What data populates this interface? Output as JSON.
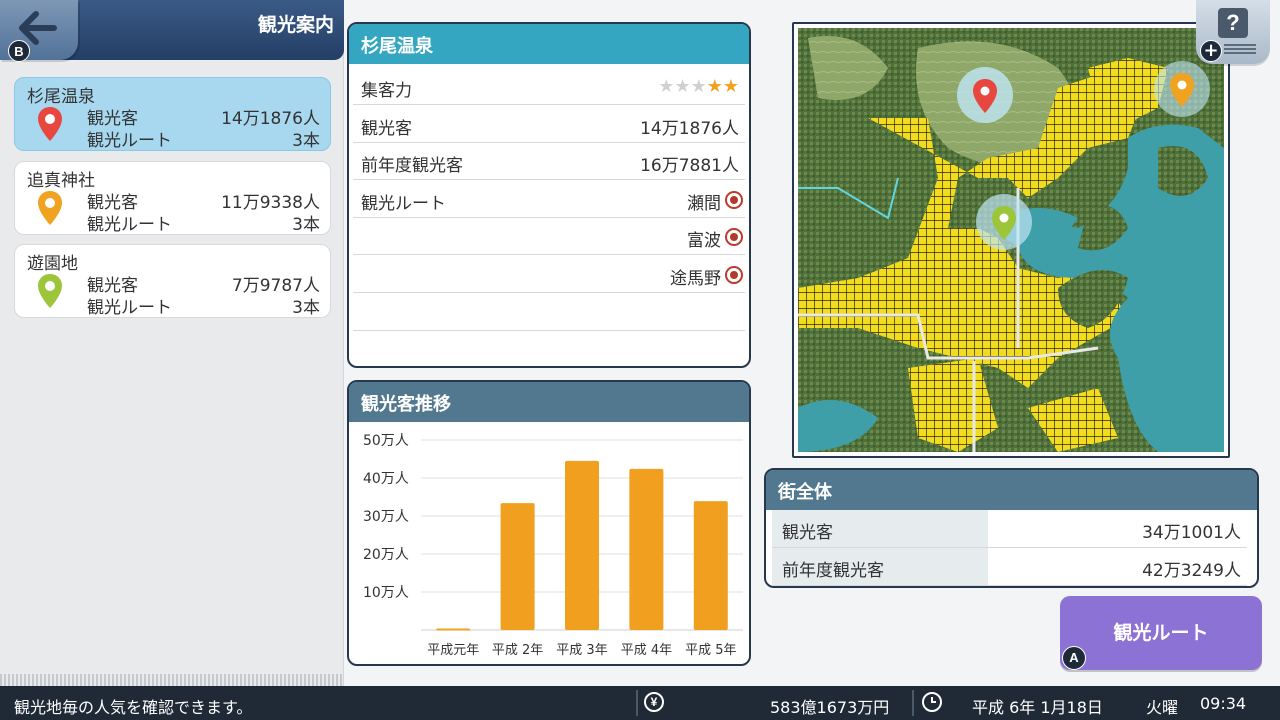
{
  "sidebar": {
    "title": "観光案内",
    "back_label": "B",
    "spots": [
      {
        "name": "杉尾温泉",
        "visitors_label": "観光客",
        "visitors": "14万1876人",
        "routes_label": "観光ルート",
        "routes": "3本",
        "pin_color": "#e8473f"
      },
      {
        "name": "追真神社",
        "visitors_label": "観光客",
        "visitors": "11万9338人",
        "routes_label": "観光ルート",
        "routes": "3本",
        "pin_color": "#f0a320"
      },
      {
        "name": "遊園地",
        "visitors_label": "観光客",
        "visitors": "7万9787人",
        "routes_label": "観光ルート",
        "routes": "3本",
        "pin_color": "#9dc53a"
      }
    ]
  },
  "detail": {
    "title": "杉尾温泉",
    "rows": {
      "attraction_label": "集客力",
      "attraction_stars": 2,
      "attraction_max": 5,
      "visitors_label": "観光客",
      "visitors": "14万1876人",
      "prev_visitors_label": "前年度観光客",
      "prev_visitors": "16万7881人",
      "routes_label": "観光ルート"
    },
    "routes": [
      "瀬間",
      "富波",
      "途馬野"
    ]
  },
  "trend": {
    "title": "観光客推移"
  },
  "chart_data": {
    "type": "bar",
    "categories": [
      "平成元年",
      "平成 2年",
      "平成 3年",
      "平成 4年",
      "平成 5年"
    ],
    "values": [
      0.4,
      33.4,
      44.5,
      42.4,
      33.9
    ],
    "ytick_labels": [
      "10万人",
      "20万人",
      "30万人",
      "40万人",
      "50万人"
    ],
    "yticks": [
      10,
      20,
      30,
      40,
      50
    ],
    "ylim": [
      0,
      50
    ],
    "unit": "万人",
    "grid": true,
    "bar_color": "#f0a01e"
  },
  "map": {
    "pins": [
      {
        "name": "杉尾温泉",
        "color": "#e8473f"
      },
      {
        "name": "追真神社",
        "color": "#f0a320"
      },
      {
        "name": "遊園地",
        "color": "#9dc53a"
      }
    ]
  },
  "help": {
    "icon": "question-icon",
    "plus": "+"
  },
  "city": {
    "title": "街全体",
    "visitors_label": "観光客",
    "visitors": "34万1001人",
    "prev_visitors_label": "前年度観光客",
    "prev_visitors": "42万3249人"
  },
  "route_button": {
    "label": "観光ルート",
    "badge": "A"
  },
  "status": {
    "message": "観光地毎の人気を確認できます。",
    "money_icon": "¥",
    "money": "583億1673万円",
    "date": "平成 6年 1月18日",
    "weekday": "火曜",
    "time": "09:34"
  },
  "colors": {
    "header_blue": "#34a6c2",
    "header_slate": "#51788e",
    "panel_border": "#27384e",
    "accent_purple": "#8d72d6",
    "status_bar": "#1f2a36"
  }
}
